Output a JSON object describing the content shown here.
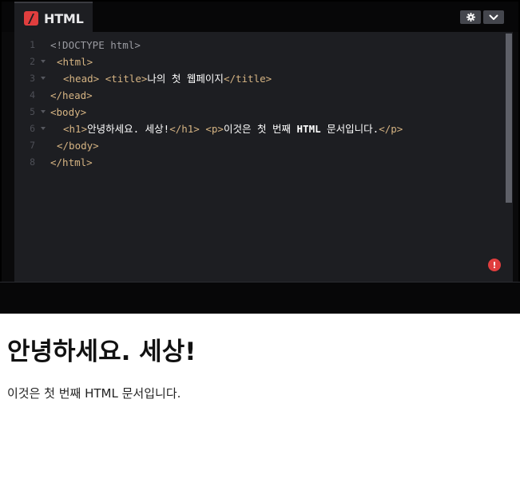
{
  "editor": {
    "tab_label": "HTML",
    "tab_icon": "html-logo-icon",
    "buttons": {
      "settings_icon": "gear-icon",
      "collapse_icon": "chevron-down-icon"
    },
    "line_numbers": [
      "1",
      "2",
      "3",
      "4",
      "5",
      "6",
      "7",
      "8"
    ],
    "code": {
      "l1": {
        "a": "<!DOCTYPE html>"
      },
      "l2": {
        "a": "<html>"
      },
      "l3": {
        "a": "<head>",
        "b": "<title>",
        "c": "나의 첫 웹페이지",
        "d": "</title>"
      },
      "l4": {
        "a": "</head>"
      },
      "l5": {
        "a": "<body>"
      },
      "l6": {
        "a": "<h1>",
        "b": "안녕하세요. 세상!",
        "c": "</h1>",
        "d": "<p>",
        "e": "이것은 첫 번째 ",
        "f": "HTML",
        "g": " 문서입니다.",
        "h": "</p>"
      },
      "l7": {
        "a": "</body>"
      },
      "l8": {
        "a": "</html>"
      }
    },
    "status_icon": "error-icon",
    "status_glyph": "!",
    "accent_color": "#e03e3e"
  },
  "preview": {
    "heading": "안녕하세요. 세상!",
    "paragraph": "이것은 첫 번째 HTML 문서입니다."
  }
}
